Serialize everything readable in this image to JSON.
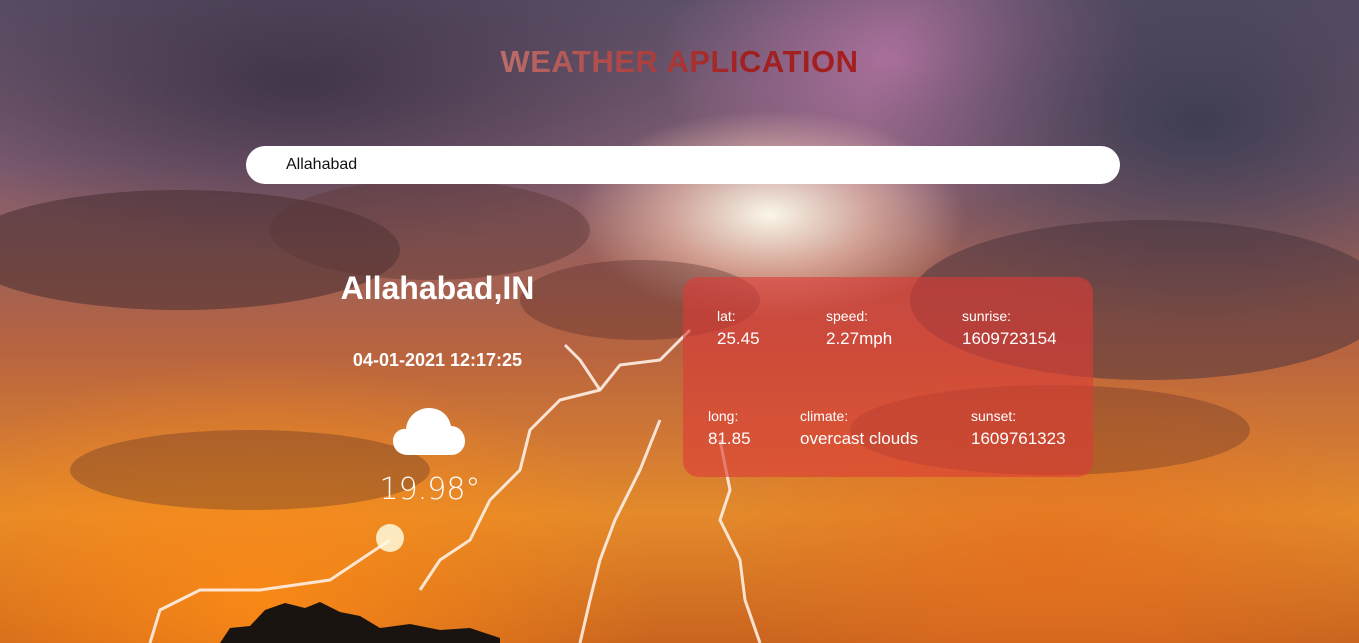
{
  "app": {
    "title": "WEATHER APLICATION"
  },
  "search": {
    "value": "Allahabad"
  },
  "location": {
    "name": "Allahabad,IN",
    "datetime": "04-01-2021 12:17:25"
  },
  "weather": {
    "icon": "cloud-icon",
    "temperature": "19.98°"
  },
  "details": {
    "lat": {
      "label": "lat:",
      "value": "25.45"
    },
    "speed": {
      "label": "speed:",
      "value": "2.27mph"
    },
    "sunrise": {
      "label": "sunrise:",
      "value": "1609723154"
    },
    "long": {
      "label": "long:",
      "value": "81.85"
    },
    "climate": {
      "label": "climate:",
      "value": "overcast clouds"
    },
    "sunset": {
      "label": "sunset:",
      "value": "1609761323"
    }
  },
  "colors": {
    "card": "#dc3c37",
    "title_accent": "#b81a1a"
  }
}
